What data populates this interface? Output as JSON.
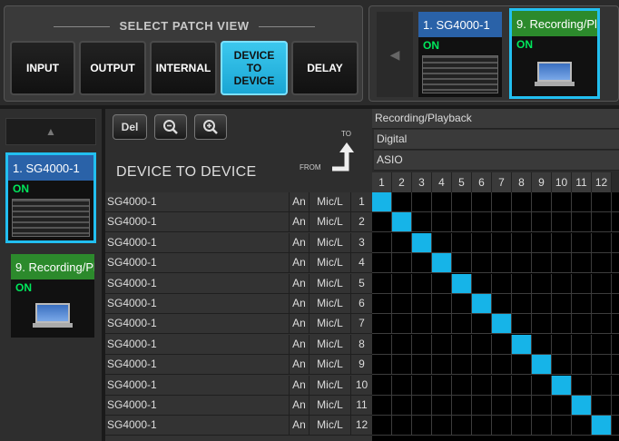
{
  "patch_view": {
    "title": "SELECT PATCH VIEW",
    "buttons": [
      {
        "label": "INPUT",
        "active": false
      },
      {
        "label": "OUTPUT",
        "active": false
      },
      {
        "label": "INTERNAL",
        "active": false
      },
      {
        "label": "DEVICE\nTO\nDEVICE",
        "active": true
      },
      {
        "label": "DELAY",
        "active": false
      }
    ]
  },
  "devices": [
    {
      "name": "1. SG4000-1",
      "status": "ON",
      "type": "rack",
      "color": "#2a62a8"
    },
    {
      "name": "9. Recording/Pl",
      "status": "ON",
      "type": "laptop",
      "color": "#2c8a2c"
    }
  ],
  "toolbar": {
    "del_label": "Del",
    "zoom_out_icon": "zoom-out-icon",
    "zoom_in_icon": "zoom-in-icon"
  },
  "page_title": "DEVICE TO DEVICE",
  "axis": {
    "to": "TO",
    "from": "FROM"
  },
  "columns_header": {
    "device": "Recording/Playback",
    "type": "Digital",
    "driver": "ASIO",
    "numbers": [
      "1",
      "2",
      "3",
      "4",
      "5",
      "6",
      "7",
      "8",
      "9",
      "10",
      "11",
      "12"
    ]
  },
  "rows": [
    {
      "name": "SG4000-1",
      "type": "An",
      "channel": "Mic/L",
      "num": "1"
    },
    {
      "name": "SG4000-1",
      "type": "An",
      "channel": "Mic/L",
      "num": "2"
    },
    {
      "name": "SG4000-1",
      "type": "An",
      "channel": "Mic/L",
      "num": "3"
    },
    {
      "name": "SG4000-1",
      "type": "An",
      "channel": "Mic/L",
      "num": "4"
    },
    {
      "name": "SG4000-1",
      "type": "An",
      "channel": "Mic/L",
      "num": "5"
    },
    {
      "name": "SG4000-1",
      "type": "An",
      "channel": "Mic/L",
      "num": "6"
    },
    {
      "name": "SG4000-1",
      "type": "An",
      "channel": "Mic/L",
      "num": "7"
    },
    {
      "name": "SG4000-1",
      "type": "An",
      "channel": "Mic/L",
      "num": "8"
    },
    {
      "name": "SG4000-1",
      "type": "An",
      "channel": "Mic/L",
      "num": "9"
    },
    {
      "name": "SG4000-1",
      "type": "An",
      "channel": "Mic/L",
      "num": "10"
    },
    {
      "name": "SG4000-1",
      "type": "An",
      "channel": "Mic/L",
      "num": "11"
    },
    {
      "name": "SG4000-1",
      "type": "An",
      "channel": "Mic/L",
      "num": "12"
    }
  ],
  "patches": [
    [
      1,
      1
    ],
    [
      2,
      2
    ],
    [
      3,
      3
    ],
    [
      4,
      4
    ],
    [
      5,
      5
    ],
    [
      6,
      6
    ],
    [
      7,
      7
    ],
    [
      8,
      8
    ],
    [
      9,
      9
    ],
    [
      10,
      10
    ],
    [
      11,
      11
    ],
    [
      12,
      12
    ]
  ],
  "colors": {
    "accent": "#16b4e8",
    "on_text": "#00e85c"
  }
}
